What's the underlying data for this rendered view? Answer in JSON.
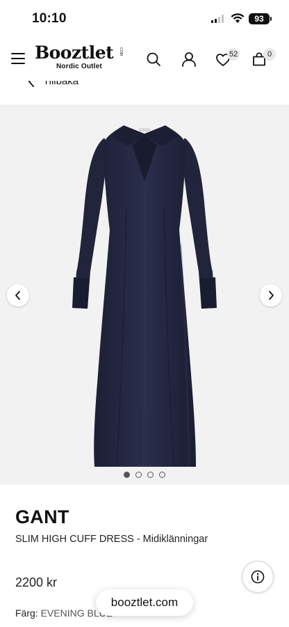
{
  "status_bar": {
    "time": "10:10",
    "battery": "93"
  },
  "header": {
    "logo_text": "Booztlet",
    "logo_com": "COM",
    "logo_subtitle": "Nordic Outlet",
    "wishlist_count": "52",
    "cart_count": "0",
    "icons": [
      "menu-icon",
      "search-icon",
      "user-icon",
      "heart-icon",
      "bag-icon"
    ]
  },
  "back_link": {
    "label": "Tillbaka"
  },
  "gallery": {
    "background": "#f2f2f2",
    "dress_color": "#24263f",
    "image_count": 4,
    "active_index": 0
  },
  "product": {
    "brand": "GANT",
    "name": "SLIM HIGH CUFF DRESS - Midiklänningar",
    "price": "2200 kr",
    "color_label": "Färg:",
    "color_value": "EVENING BLUE"
  },
  "browser": {
    "url": "booztlet.com"
  }
}
